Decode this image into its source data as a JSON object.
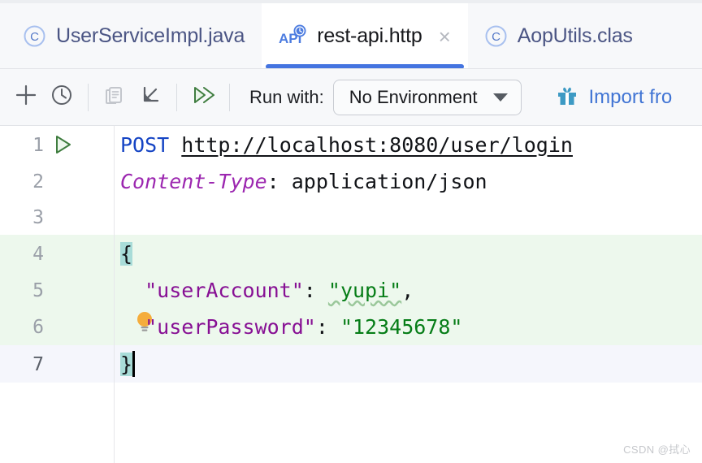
{
  "window": {
    "app": "IntelliJ IDEA HTTP Client Editor"
  },
  "tabs": [
    {
      "label": "UserServiceImpl.java",
      "icon": "java-class-icon",
      "active": false,
      "closable": false
    },
    {
      "label": "rest-api.http",
      "icon": "http-api-icon",
      "active": true,
      "closable": true,
      "close_glyph": "×"
    },
    {
      "label": "AopUtils.clas",
      "icon": "java-class-icon",
      "active": false,
      "closable": false
    }
  ],
  "toolbar": {
    "buttons": [
      {
        "name": "add-request-button",
        "icon": "plus-icon"
      },
      {
        "name": "request-history-button",
        "icon": "clock-icon"
      },
      {
        "name": "open-log-button",
        "icon": "document-icon",
        "disabled": true
      },
      {
        "name": "convert-to-curl-button",
        "icon": "arrow-down-left-icon"
      },
      {
        "name": "run-all-requests-button",
        "icon": "double-play-icon"
      }
    ],
    "run_with_label": "Run with:",
    "environment": {
      "selected": "No Environment",
      "options": [
        "No Environment"
      ]
    },
    "import_label": "Import fro",
    "import_icon": "gift-icon"
  },
  "editor": {
    "lines": [
      {
        "no": "1",
        "gutter_icon": "run-request-icon",
        "highlight": "none"
      },
      {
        "no": "2",
        "gutter_icon": null,
        "highlight": "none"
      },
      {
        "no": "3",
        "gutter_icon": null,
        "highlight": "none"
      },
      {
        "no": "4",
        "gutter_icon": null,
        "highlight": "body"
      },
      {
        "no": "5",
        "gutter_icon": null,
        "highlight": "body"
      },
      {
        "no": "6",
        "gutter_icon": null,
        "highlight": "body",
        "has_intention_bulb": true
      },
      {
        "no": "7",
        "gutter_icon": null,
        "highlight": "current"
      }
    ],
    "code": {
      "line1_method": "POST",
      "line1_space": " ",
      "line1_url": "http://localhost:8080/user/login",
      "line2_header_name": "Content-Type",
      "line2_colon": ": ",
      "line2_header_value": "application/json",
      "line4_open_brace": "{",
      "line5_indent": "  ",
      "line5_key": "\"userAccount\"",
      "line5_colon": ": ",
      "line5_value": "\"yupi\"",
      "line5_comma": ",",
      "line6_indent": "  ",
      "line6_key": "\"userPassword\"",
      "line6_colon": ": ",
      "line6_value": "\"12345678\"",
      "line7_close_brace": "}"
    }
  },
  "watermark": "CSDN @拭心",
  "colors": {
    "accent_blue": "#4474e0",
    "method_blue": "#1544c4",
    "header_purple": "#9c27b0",
    "json_key_purple": "#871094",
    "string_green": "#067d17",
    "body_bg_green": "#edf8ed",
    "current_line": "#f5f6fc",
    "brace_match": "#a8dcd8",
    "link_blue": "#4074d4",
    "toolbar_bg": "#f7f8fa"
  }
}
